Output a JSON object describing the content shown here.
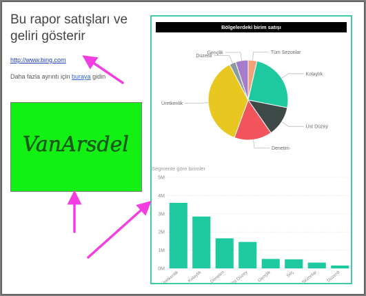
{
  "report": {
    "title": "Bu rapor satışları ve geliri gösterir",
    "link_text": "http://www.bing.com",
    "more_prefix": "Daha fazla ayrıntı için ",
    "more_link": "buraya",
    "more_suffix": " gidin",
    "logo_text": "VanArsdel"
  },
  "colors": {
    "accent": "#3ec9a7",
    "logo_bg": "#13f013",
    "arrow": "#f23ee0",
    "bar": "#1fc9a0"
  },
  "chart_data": [
    {
      "type": "pie",
      "title": "Bölgelerdeki birim satışı",
      "categories": [
        "Tüm Sezonlar",
        "Kolaylık",
        "Üst Düzey",
        "Denetim",
        "Üretkenlik",
        "Düzenli",
        "Gençlik"
      ],
      "values": [
        3.5,
        24,
        12,
        15,
        36,
        2.5,
        5
      ],
      "colors": [
        "#f0a37a",
        "#1fc9a0",
        "#3d4a48",
        "#f2545c",
        "#e8c820",
        "#8a9ca0",
        "#a57bcc"
      ]
    },
    {
      "type": "bar",
      "title": "Segmente göre birimler",
      "categories": [
        "Üretkenlik",
        "Kolaylık",
        "Denetim",
        "Üst Düzey",
        "Gençlik",
        "Seç",
        "Tüm Sezonlar",
        "Düzenli"
      ],
      "values": [
        3.6,
        2.85,
        1.65,
        1.45,
        0.52,
        0.5,
        0.32,
        0.16
      ],
      "yticks": [
        "0M",
        "1M",
        "2M",
        "3M",
        "4M",
        "5M"
      ],
      "ylim": [
        0,
        5
      ]
    }
  ]
}
